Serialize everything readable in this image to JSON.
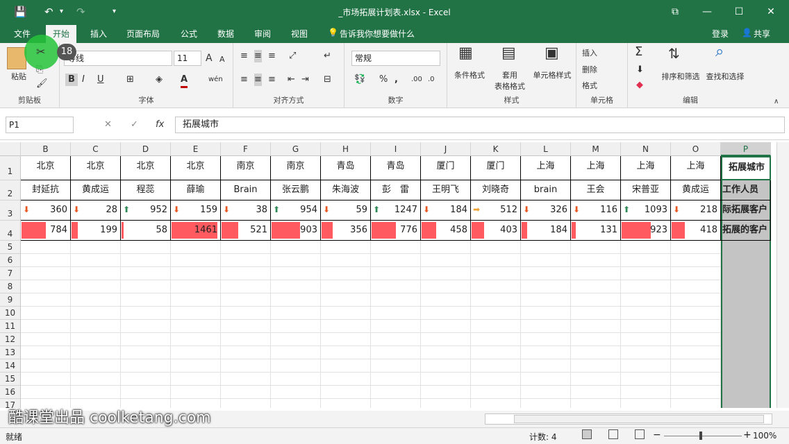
{
  "window": {
    "title": "_市场拓展计划表.xlsx - Excel",
    "restore_glyph": "⧉",
    "min_glyph": "—",
    "max_glyph": "☐",
    "close_glyph": "✕"
  },
  "quick_access": {
    "save_icon": "save-icon",
    "undo_icon": "undo-icon",
    "redo_icon": "redo-icon",
    "save_glyph": "💾",
    "undo_glyph": "↶",
    "redo_glyph": "↷",
    "more_glyph": "▾"
  },
  "tabs": [
    "文件",
    "开始",
    "插入",
    "页面布局",
    "公式",
    "数据",
    "审阅",
    "视图"
  ],
  "tell_me": "告诉我你想要做什么",
  "login": "登录",
  "share": "共享",
  "ribbon": {
    "clipboard": {
      "label": "剪贴板",
      "paste": "粘贴"
    },
    "font": {
      "label": "字体",
      "name": "等线",
      "size": "11",
      "bold": "B",
      "italic": "I",
      "underline": "U",
      "grow": "A",
      "shrink": "A",
      "font_color": "A",
      "phonetic": "wén"
    },
    "align": {
      "label": "对齐方式"
    },
    "number": {
      "label": "数字",
      "format": "常规",
      "percent": "%",
      "comma": ","
    },
    "styles": {
      "label": "样式",
      "conditional": "条件格式",
      "table_a": "套用",
      "table_b": "表格格式",
      "cell_styles": "单元格样式"
    },
    "cells": {
      "label": "单元格",
      "insert": "插入",
      "delete": "删除",
      "format": "格式"
    },
    "editing": {
      "label": "编辑",
      "sort": "排序和筛选",
      "find": "查找和选择",
      "sum": "Σ"
    }
  },
  "formula_bar": {
    "name_box": "P1",
    "cancel": "✕",
    "enter": "✓",
    "fx": "fx",
    "content": "拓展城市"
  },
  "columns": [
    "B",
    "C",
    "D",
    "E",
    "F",
    "G",
    "H",
    "I",
    "J",
    "K",
    "L",
    "M",
    "N",
    "O",
    "P"
  ],
  "rows": [
    "1",
    "2",
    "3",
    "4",
    "5",
    "6",
    "7",
    "8",
    "9",
    "10",
    "11",
    "12",
    "13",
    "14",
    "15",
    "16",
    "17"
  ],
  "table": {
    "cities": [
      "北京",
      "北京",
      "北京",
      "北京",
      "南京",
      "南京",
      "青岛",
      "青岛",
      "厦门",
      "厦门",
      "上海",
      "上海",
      "上海",
      "上海"
    ],
    "staff": [
      "封延抗",
      "黄成运",
      "程蕊",
      "薛瑜",
      "Brain",
      "张云鹏",
      "朱海波",
      "彭　雷",
      "王明飞",
      "刘晓奇",
      "brain",
      "王会",
      "宋普亚",
      "黄成运"
    ],
    "row3": [
      360,
      28,
      952,
      159,
      38,
      954,
      59,
      1247,
      184,
      512,
      326,
      116,
      1093,
      218
    ],
    "row3_icons": [
      "down",
      "down",
      "up",
      "down",
      "down",
      "up",
      "down",
      "up",
      "down",
      "side",
      "down",
      "down",
      "up",
      "down"
    ],
    "row4": [
      784,
      199,
      58,
      1461,
      521,
      903,
      356,
      776,
      458,
      403,
      184,
      131,
      923,
      418
    ],
    "p_col": [
      "拓展城市",
      "工作人员",
      "际拓展客户",
      "拓展的客户"
    ]
  },
  "icon_colors": {
    "up": "#2e8b57",
    "down": "#e8571f",
    "side": "#f0a030",
    "bar": "#ff5a5f",
    "accent": "#217346"
  },
  "click_badge": "18",
  "status": {
    "ready": "就绪",
    "count": "计数: 4",
    "zoom": "100%",
    "zoom_out": "−",
    "zoom_in": "+"
  },
  "watermark": "酷课堂出品 coolketang.com"
}
